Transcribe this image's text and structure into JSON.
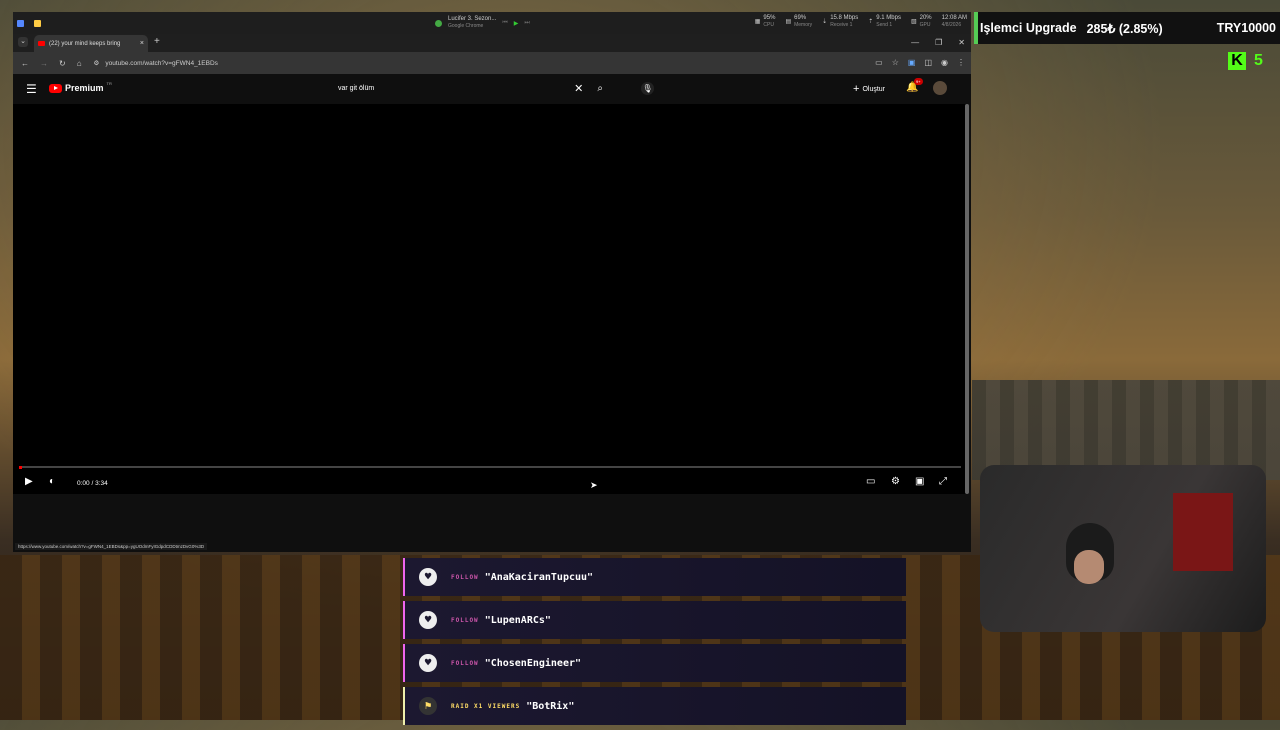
{
  "os_bar": {
    "media_title": "Lucifer 3. Sezon...",
    "media_sub": "Google Chrome",
    "stats": [
      {
        "value": "95%",
        "label": "CPU"
      },
      {
        "value": "69%",
        "label": "Memory"
      },
      {
        "value": "15.8 Mbps",
        "label": "Receive 1"
      },
      {
        "value": "9.1 Mbps",
        "label": "Send 1"
      },
      {
        "value": "20%",
        "label": "GPU"
      },
      {
        "value": "12:08 AM",
        "label": "4/8/2026"
      }
    ]
  },
  "tab": {
    "title": "(22) your mind keeps bring",
    "close": "×",
    "new": "+"
  },
  "address": {
    "url": "youtube.com/watch?v=gFWN4_1EBDs"
  },
  "youtube": {
    "logo_text": "Premium",
    "country": "TR",
    "search_value": "var git ölüm",
    "create_label": "Oluştur",
    "notification_badge": "9+"
  },
  "player": {
    "time": "0:00 / 3:34"
  },
  "status_url": "https://www.youtube.com/watch?v=gFWN4_1EBDs&pp=ygUOdmFyIGdpdCDDtmzDvG0%3D",
  "ticker": {
    "name": "Işlemci Upgrade",
    "points": "285₺ (2.85%)",
    "prize": "TRY10000"
  },
  "kick": {
    "letter": "K",
    "count": "5"
  },
  "alerts": [
    {
      "tag": "FOLLOW",
      "user": "\"AnaKaciranTupcuu\""
    },
    {
      "tag": "FOLLOW",
      "user": "\"LupenARCs\""
    },
    {
      "tag": "FOLLOW",
      "user": "\"ChosenEngineer\""
    },
    {
      "tag": "RAID X1 VIEWERS",
      "user": "\"BotRix\""
    }
  ]
}
